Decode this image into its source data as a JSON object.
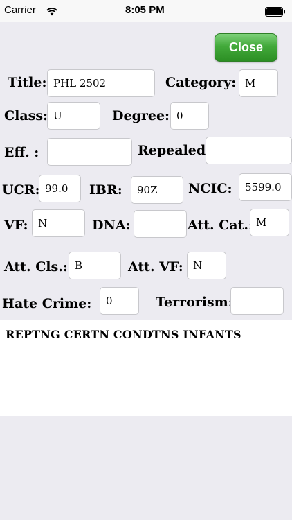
{
  "status_bar": {
    "carrier": "Carrier",
    "time": "8:05 PM"
  },
  "toolbar": {
    "close_label": "Close"
  },
  "form": {
    "title": {
      "label": "Title:",
      "value": "PHL 2502"
    },
    "category": {
      "label": "Category:",
      "value": "M"
    },
    "class": {
      "label": "Class:",
      "value": "U"
    },
    "degree": {
      "label": "Degree:",
      "value": "0"
    },
    "eff": {
      "label": "Eff. :",
      "value": ""
    },
    "repealed": {
      "label": "Repealed:",
      "value": ""
    },
    "ucr": {
      "label": "UCR:",
      "value": "99.0"
    },
    "ibr": {
      "label": "IBR:",
      "value": "90Z"
    },
    "ncic": {
      "label": "NCIC:",
      "value": "5599.0"
    },
    "vf": {
      "label": "VF:",
      "value": "N"
    },
    "dna": {
      "label": "DNA:",
      "value": ""
    },
    "att_cat": {
      "label": "Att. Cat.:",
      "value": "M"
    },
    "att_cls": {
      "label": "Att. Cls.:",
      "value": "B"
    },
    "att_vf": {
      "label": "Att. VF:",
      "value": "N"
    },
    "hate_crime": {
      "label": "Hate Crime:",
      "value": "0"
    },
    "terrorism": {
      "label": "Terrorism:",
      "value": ""
    }
  },
  "description": "REPTNG CERTN CONDTNS INFANTS",
  "battery": {
    "level_fraction": 1.0
  }
}
